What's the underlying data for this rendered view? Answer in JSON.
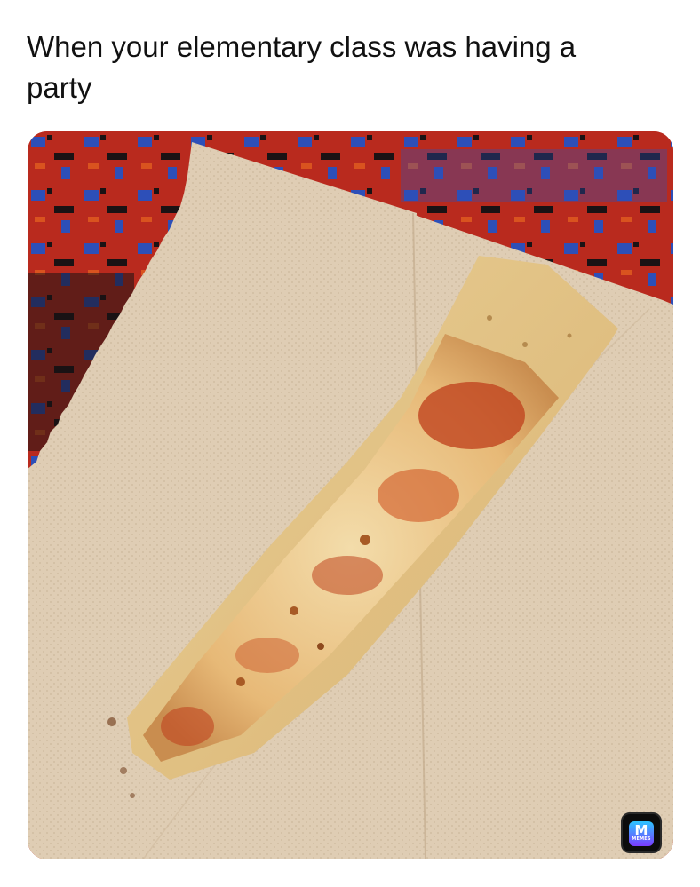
{
  "post": {
    "caption": "When your elementary class was having a party"
  },
  "photo": {
    "subject_icon": "pizza-slice-photo",
    "colors": {
      "rug_red": "#b92a1e",
      "rug_blue": "#2d4fb8",
      "rug_dark": "#1a1214",
      "paper_towel": "#dfcdb4",
      "crust": "#e6c68a",
      "cheese": "#efcf96",
      "sauce": "#c0451f"
    }
  },
  "watermark": {
    "icon": "memes-app-icon",
    "label": "MEMES",
    "glyph": "M"
  }
}
